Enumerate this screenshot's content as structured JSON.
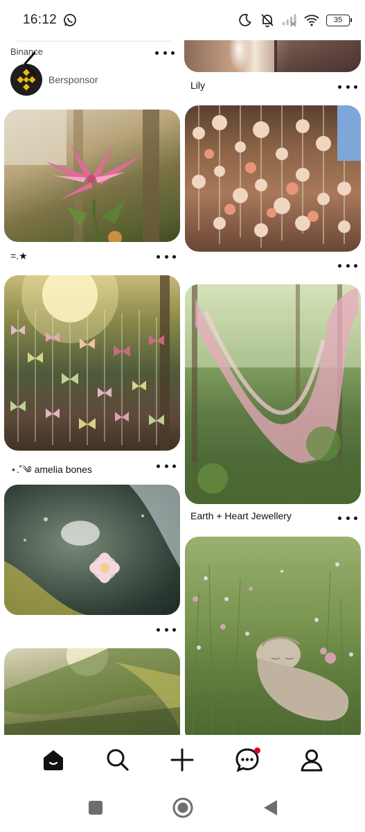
{
  "status_bar": {
    "time": "16:12",
    "battery": "35",
    "icons": [
      "whatsapp-icon",
      "moon-icon",
      "bell-off-icon",
      "signal-icon",
      "wifi-icon",
      "battery-icon"
    ]
  },
  "feed": {
    "sponsored": {
      "advertiser": "Binance",
      "sponsor_label": "Bersponsor"
    },
    "pins": [
      {
        "id": "lily",
        "title": "Lily"
      },
      {
        "id": "pink-lily",
        "title": "=.★"
      },
      {
        "id": "shell-mobiles",
        "title": ""
      },
      {
        "id": "butterfly-suncatcher",
        "title": "⋆.˚༄ amelia bones"
      },
      {
        "id": "pink-fabric-forest",
        "title": "Earth + Heart Jewellery"
      },
      {
        "id": "pond-flower",
        "title": ""
      },
      {
        "id": "garden-statue",
        "title": ""
      },
      {
        "id": "sunlit-trees",
        "title": ""
      }
    ]
  },
  "bottom_nav": {
    "items": [
      "home-icon",
      "search-icon",
      "create-icon",
      "messages-icon",
      "profile-icon"
    ],
    "accent": "#e60023"
  }
}
